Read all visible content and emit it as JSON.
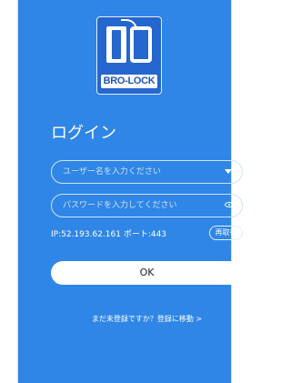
{
  "logo": {
    "brand_text": "BRO-LOCK"
  },
  "login": {
    "title": "ログイン",
    "username_placeholder": "ユーザー名を入力ください",
    "password_placeholder": "パスワードを入力してください",
    "server_info": "IP:52.193.62.161  ポート:443",
    "refetch_label": "再取得",
    "ok_label": "OK",
    "register_link": "まだ未登録ですか？登録に移動 >"
  },
  "colors": {
    "background": "#2f86e6",
    "logo_bg": "#2566cf",
    "button_bg": "#ffffff"
  },
  "icons": {
    "dropdown": "chevron-down-icon",
    "password_visibility": "eye-icon"
  }
}
